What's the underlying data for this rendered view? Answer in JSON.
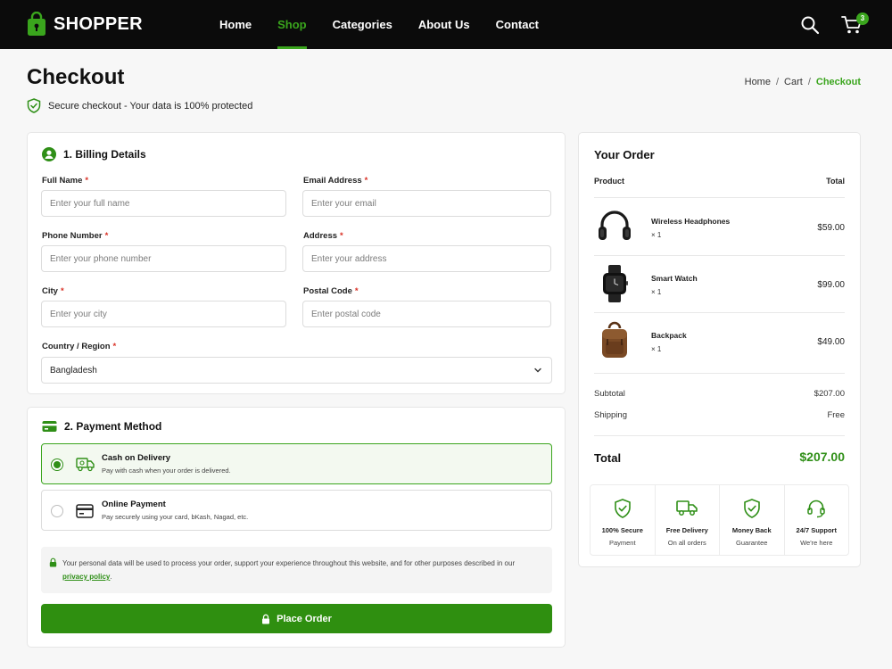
{
  "header": {
    "brand": "SHOPPER",
    "nav": [
      {
        "label": "Home",
        "active": false
      },
      {
        "label": "Shop",
        "active": true
      },
      {
        "label": "Categories",
        "active": false
      },
      {
        "label": "About Us",
        "active": false
      },
      {
        "label": "Contact",
        "active": false
      }
    ],
    "cart_count": "3",
    "icons": {
      "search": "search-icon",
      "cart": "cart-icon",
      "logo": "shopping-bag-icon"
    }
  },
  "page": {
    "title": "Checkout",
    "secure_note": "Secure checkout - Your data is 100% protected",
    "breadcrumb": {
      "home": "Home",
      "sep": "/",
      "cart": "Cart",
      "current": "Checkout"
    }
  },
  "billing": {
    "title": "1. Billing Details",
    "fields": {
      "full_name": {
        "label": "Full Name",
        "placeholder": "Enter your full name",
        "required": "*"
      },
      "email": {
        "label": "Email Address",
        "placeholder": "Enter your email",
        "required": "*"
      },
      "phone": {
        "label": "Phone Number",
        "placeholder": "Enter your phone number",
        "required": "*"
      },
      "address": {
        "label": "Address",
        "placeholder": "Enter your address",
        "required": "*"
      },
      "city": {
        "label": "City",
        "placeholder": "Enter your city",
        "required": "*"
      },
      "postal": {
        "label": "Postal Code",
        "placeholder": "Enter postal code",
        "required": "*"
      },
      "country": {
        "label": "Country / Region",
        "value": "Bangladesh",
        "required": "*"
      }
    }
  },
  "payment": {
    "title": "2. Payment Method",
    "options": [
      {
        "title": "Cash on Delivery",
        "desc": "Pay with cash when your order is delivered.",
        "selected": true,
        "icon": "cash-delivery-icon"
      },
      {
        "title": "Online Payment",
        "desc": "Pay securely using your card, bKash, Nagad, etc.",
        "selected": false,
        "icon": "credit-card-icon"
      }
    ],
    "privacy_text": "Your personal data will be used to process your order, support your experience throughout this website, and for other purposes described in our",
    "privacy_link": "privacy policy",
    "privacy_end": ".",
    "place_order": "Place Order"
  },
  "order": {
    "title": "Your Order",
    "col_product": "Product",
    "col_total": "Total",
    "items": [
      {
        "name": "Wireless Headphones",
        "qty": "× 1",
        "price": "$59.00",
        "icon": "headphones-icon"
      },
      {
        "name": "Smart Watch",
        "qty": "× 1",
        "price": "$99.00",
        "icon": "smartwatch-icon"
      },
      {
        "name": "Backpack",
        "qty": "× 1",
        "price": "$49.00",
        "icon": "backpack-icon"
      }
    ],
    "subtotal_label": "Subtotal",
    "subtotal": "$207.00",
    "shipping_label": "Shipping",
    "shipping": "Free",
    "total_label": "Total",
    "total": "$207.00",
    "badges": [
      {
        "title": "100% Secure",
        "sub": "Payment",
        "icon": "shield-check-icon"
      },
      {
        "title": "Free Delivery",
        "sub": "On all orders",
        "icon": "truck-icon"
      },
      {
        "title": "Money Back",
        "sub": "Guarantee",
        "icon": "badge-check-icon"
      },
      {
        "title": "24/7 Support",
        "sub": "We're here",
        "icon": "headset-icon"
      }
    ]
  },
  "colors": {
    "accent": "#2f8f17",
    "header_bg": "#0b0b0b",
    "required": "#d93025"
  }
}
